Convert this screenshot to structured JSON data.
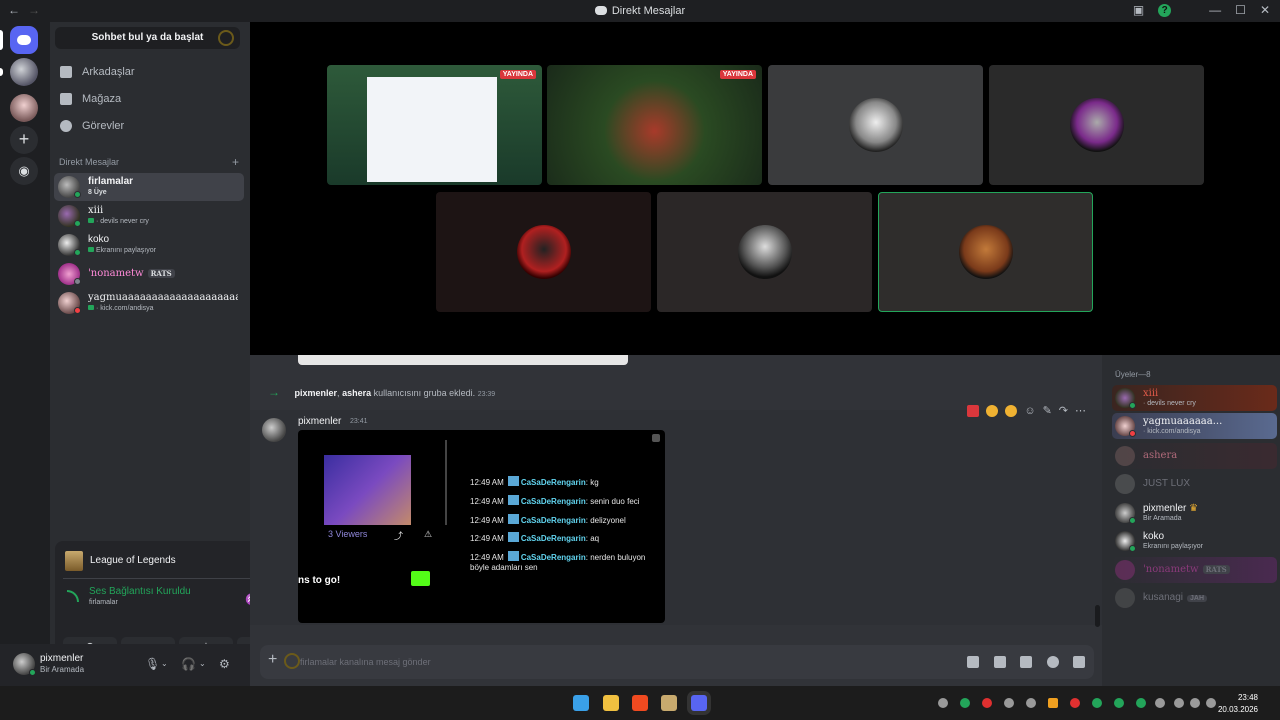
{
  "window": {
    "title": "Direkt Mesajlar",
    "back_icon": "arrow-left-icon",
    "forward_icon": "arrow-right-icon"
  },
  "sidebar": {
    "search_label": "Sohbet bul ya da başlat",
    "nav": [
      {
        "label": "Arkadaşlar",
        "icon": "friends-icon"
      },
      {
        "label": "Mağaza",
        "icon": "store-icon"
      },
      {
        "label": "Görevler",
        "icon": "quests-icon"
      }
    ],
    "dm_header": "Direkt Mesajlar",
    "dms": [
      {
        "name": "firlamalar",
        "sub": "8 Üye"
      },
      {
        "name": "xiii",
        "sub": "· devils never cry"
      },
      {
        "name": "koko",
        "sub": "Ekranını paylaşıyor"
      },
      {
        "name": "'nonametw",
        "tag": "RATS"
      },
      {
        "name": "yagmuaaaaaaaaaaaaaaaaaaaa...",
        "sub": "· kick.com/andisya"
      }
    ]
  },
  "activity_panel": {
    "game": "League of Legends",
    "voice_status": "Ses Bağlantısı Kuruldu",
    "voice_channel": "firlamalar"
  },
  "user_panel": {
    "name": "pixmenler",
    "status": "Bir Aramada"
  },
  "stage": {
    "live_label": "YAYINDA"
  },
  "chat": {
    "system_message": {
      "actor": "pixmenler",
      "target": "ashera",
      "text": "kullanıcısını gruba ekledi.",
      "time": "23:39"
    },
    "message": {
      "author": "pixmenler",
      "time": "23:41",
      "viewers": "3 Viewers",
      "banner_text": "ns to go!",
      "chat_lines": [
        {
          "time": "12:49 AM",
          "user": "CaSaDeRengarin",
          "text": "kg"
        },
        {
          "time": "12:49 AM",
          "user": "CaSaDeRengarin",
          "text": "senin duo feci"
        },
        {
          "time": "12:49 AM",
          "user": "CaSaDeRengarin",
          "text": "delizyonel"
        },
        {
          "time": "12:49 AM",
          "user": "CaSaDeRengarin",
          "text": "aq"
        },
        {
          "time": "12:49 AM",
          "user": "CaSaDeRengarin",
          "text": "nerden buluyon"
        },
        {
          "time": "",
          "user": "",
          "text": "böyle adamları sen"
        }
      ]
    },
    "composer_placeholder": "firlamalar kanalına mesaj gönder"
  },
  "members": {
    "header": "Üyeler—8",
    "list": [
      {
        "name": "xiii",
        "sub": "· devils never cry"
      },
      {
        "name": "yagmuaaaaaa...",
        "sub": "· kick.com/andisya"
      },
      {
        "name": "ashera",
        "sub": ""
      },
      {
        "name": "JUST LUX",
        "sub": ""
      },
      {
        "name": "pixmenler",
        "sub": "Bir Aramada"
      },
      {
        "name": "koko",
        "sub": "Ekranını paylaşıyor"
      },
      {
        "name": "'nonametw",
        "tag": "RATS"
      },
      {
        "name": "kusanagi",
        "tag": "JAH"
      }
    ]
  },
  "taskbar": {
    "time": "23:48",
    "date": "20.03.2026"
  }
}
